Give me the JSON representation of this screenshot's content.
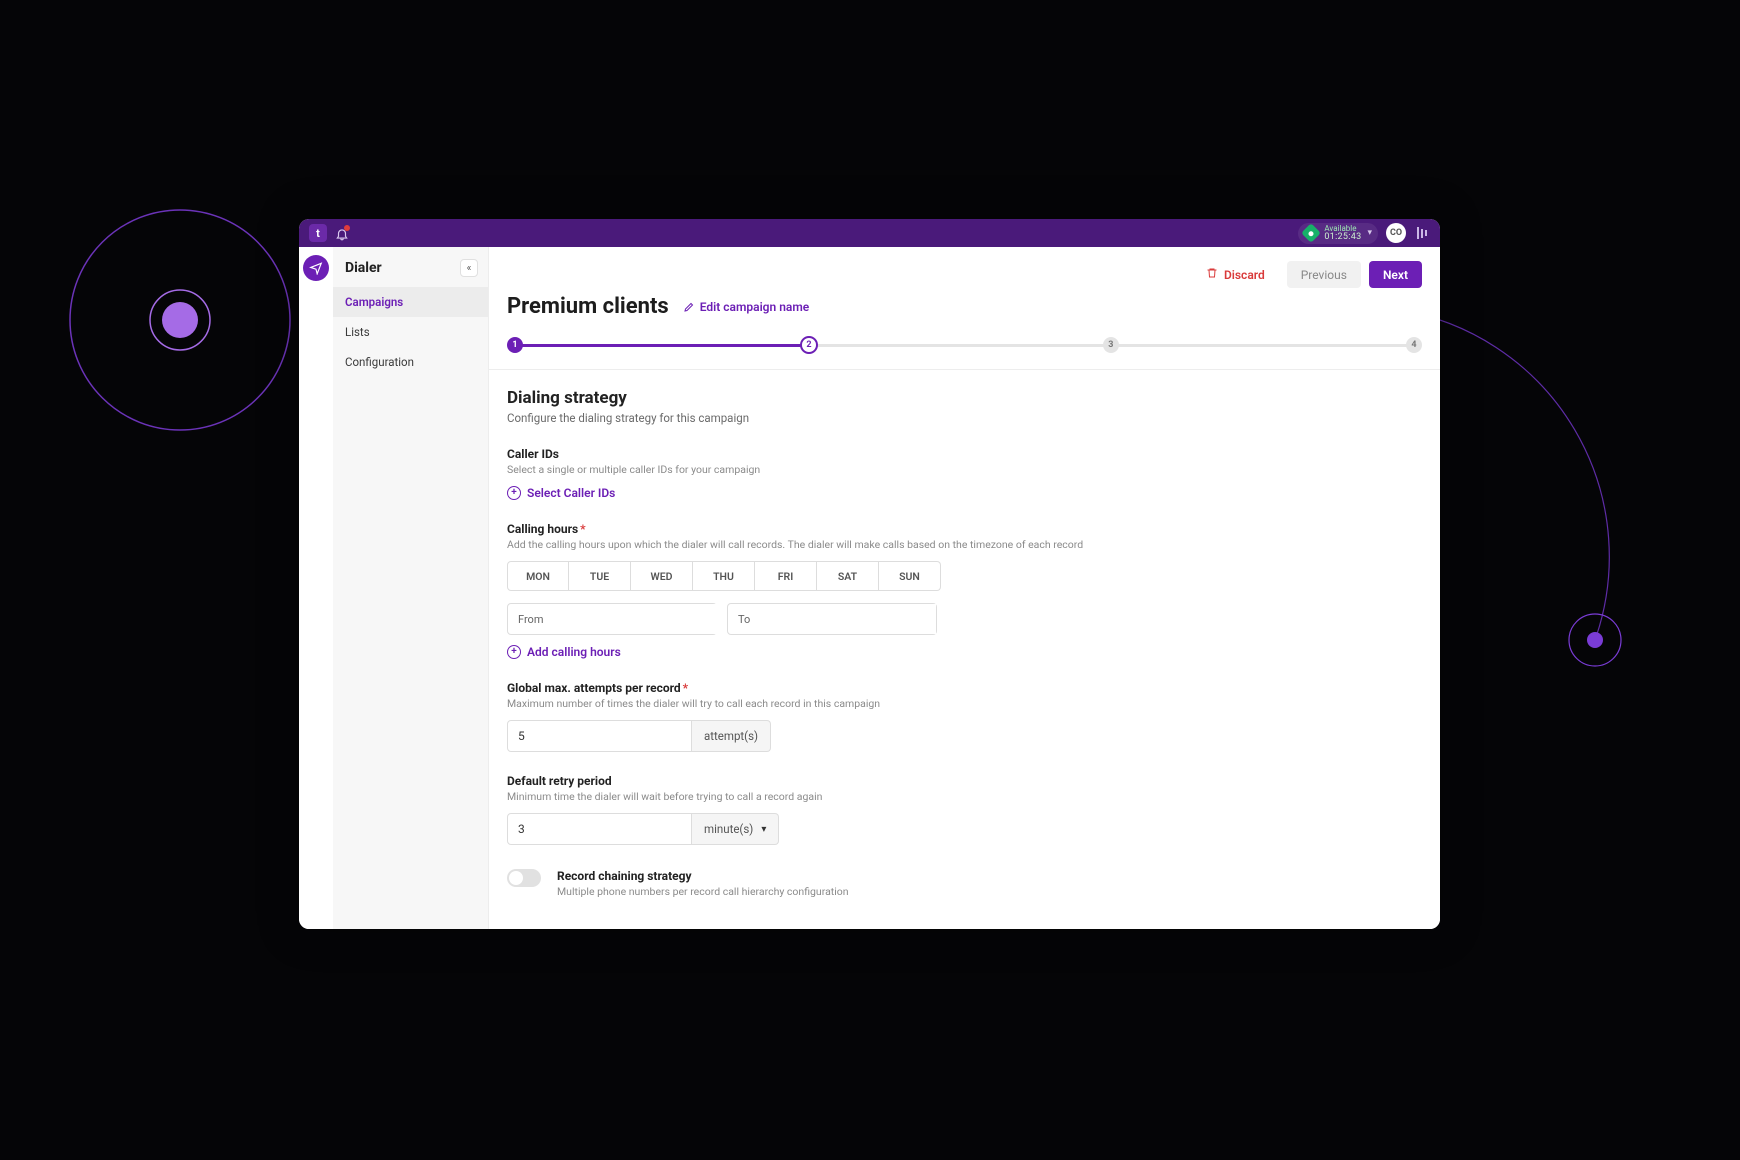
{
  "topbar": {
    "logo_text": "t",
    "status_label": "Available",
    "status_timer": "01:25:43",
    "avatar_initials": "CO"
  },
  "sidebar": {
    "title": "Dialer",
    "items": [
      {
        "label": "Campaigns",
        "active": true
      },
      {
        "label": "Lists",
        "active": false
      },
      {
        "label": "Configuration",
        "active": false
      }
    ]
  },
  "page": {
    "title": "Premium clients",
    "edit_link": "Edit campaign name",
    "discard": "Discard",
    "previous": "Previous",
    "next": "Next"
  },
  "stepper": {
    "current": 2,
    "total": 4,
    "labels": [
      "1",
      "2",
      "3",
      "4"
    ]
  },
  "strategy": {
    "heading": "Dialing strategy",
    "sub": "Configure the dialing strategy for this campaign",
    "caller_ids_label": "Caller IDs",
    "caller_ids_help": "Select a single or multiple caller IDs for your campaign",
    "select_caller_ids": "Select Caller IDs",
    "calling_hours_label": "Calling hours",
    "calling_hours_help": "Add the calling hours upon which the dialer will call records. The dialer will make calls based on the timezone of each record",
    "days": [
      "MON",
      "TUE",
      "WED",
      "THU",
      "FRI",
      "SAT",
      "SUN"
    ],
    "from_label": "From",
    "to_label": "To",
    "add_calling_hours": "Add calling hours",
    "max_attempts_label": "Global max. attempts per record",
    "max_attempts_help": "Maximum number of times the dialer will try to call each record in this campaign",
    "max_attempts_value": "5",
    "attempts_suffix": "attempt(s)",
    "retry_label": "Default retry period",
    "retry_help": "Minimum time the dialer will wait before trying to call a record again",
    "retry_value": "3",
    "retry_unit": "minute(s)",
    "chaining_title": "Record chaining strategy",
    "chaining_sub": "Multiple phone numbers per record call hierarchy configuration"
  }
}
